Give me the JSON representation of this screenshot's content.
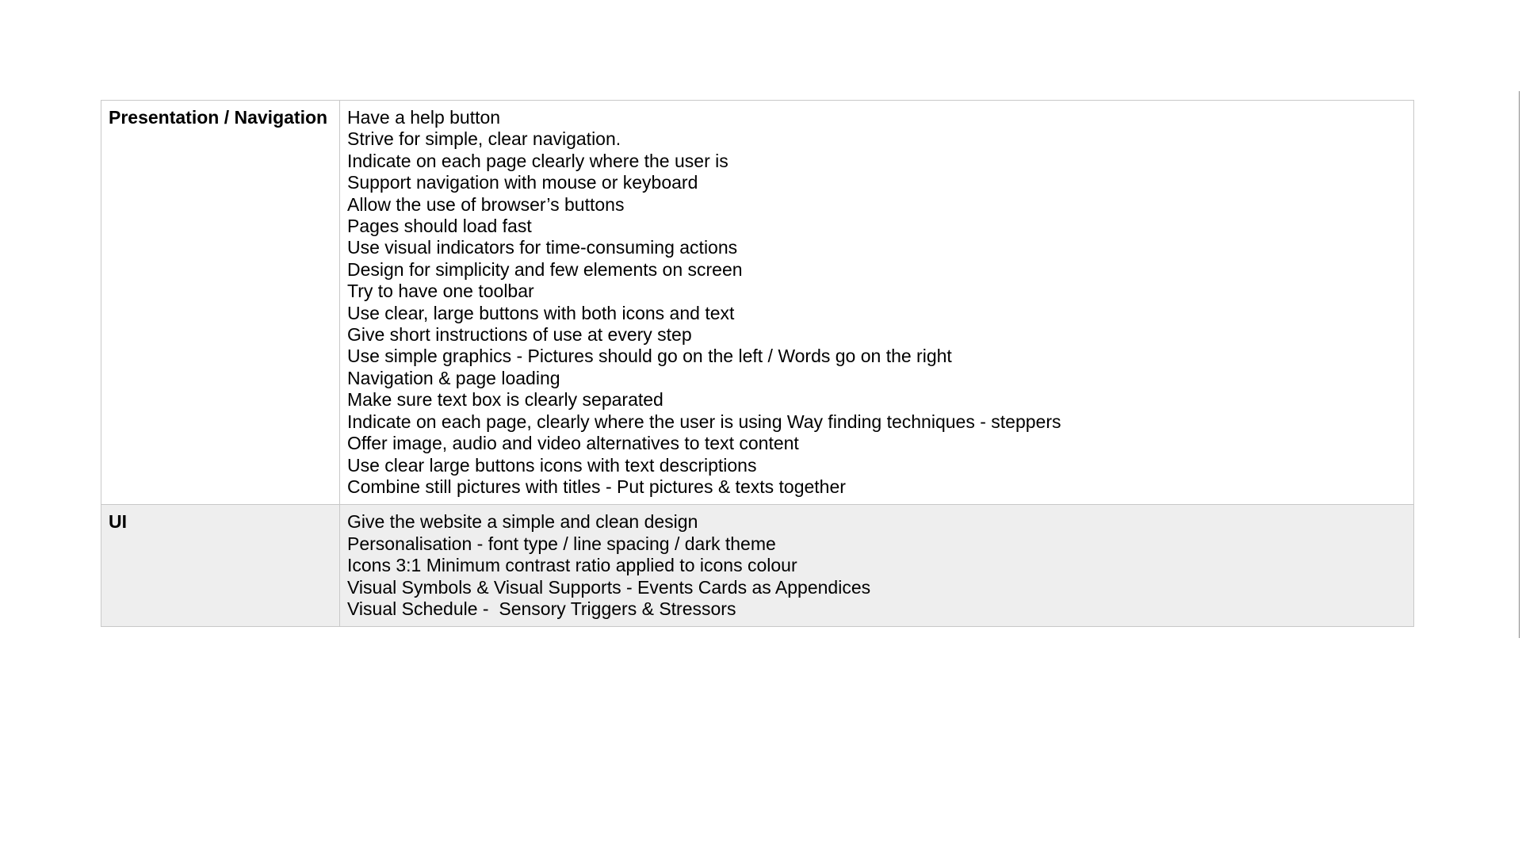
{
  "table": {
    "rows": [
      {
        "category": "Presentation / Navigation",
        "items": [
          "Have a help button",
          "Strive for simple, clear navigation.",
          "Indicate on each page clearly where the user is",
          "Support navigation with mouse or keyboard",
          "Allow the use of browser’s buttons",
          "Pages should load fast",
          "Use visual indicators for time-consuming actions",
          "Design for simplicity and few elements on screen",
          "Try to have one toolbar",
          "Use clear, large buttons with both icons and text",
          "Give short instructions of use at every step",
          "Use simple graphics - Pictures should go on the left / Words go on the right",
          "Navigation & page loading",
          "Make sure text box is clearly separated",
          "Indicate on each page, clearly where the user is using Way finding techniques - steppers",
          "Offer image, audio and video alternatives to text content",
          "Use clear large buttons icons with text descriptions",
          "Combine still pictures with titles - Put pictures & texts together"
        ]
      },
      {
        "category": "UI",
        "items": [
          "Give the website a simple and clean design",
          "Personalisation - font type / line spacing / dark theme",
          "Icons 3:1 Minimum contrast ratio applied to icons colour",
          "Visual Symbols & Visual Supports - Events Cards as Appendices",
          "Visual Schedule -  Sensory Triggers & Stressors"
        ]
      }
    ]
  },
  "colors": {
    "border": "#c8c8c8",
    "shaded_row": "#eeeeee",
    "text": "#000000"
  }
}
